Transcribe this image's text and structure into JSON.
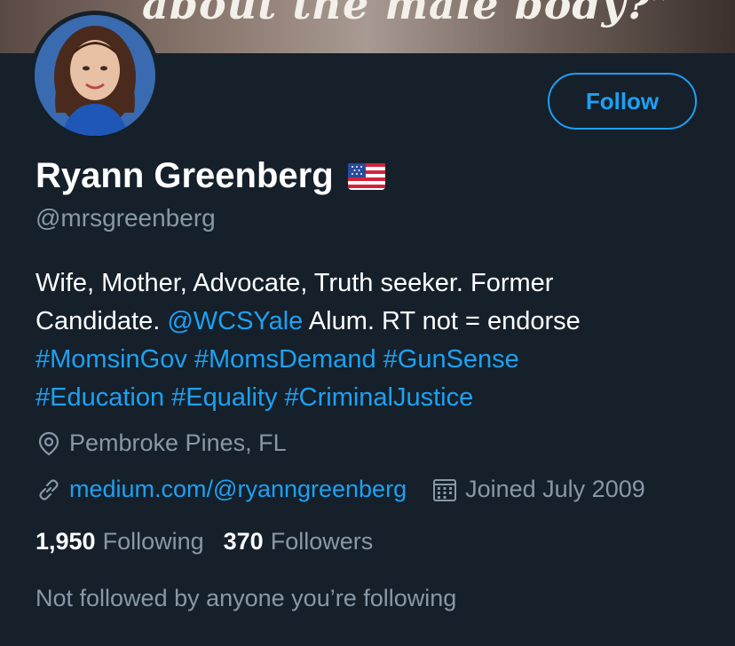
{
  "banner": {
    "text": "about the male body?”"
  },
  "profile": {
    "name": "Ryann Greenberg",
    "handle": "@mrsgreenberg",
    "follow_label": "Follow"
  },
  "bio": {
    "line1": "Wife, Mother, Advocate, Truth seeker. Former",
    "line2_pre": "Candidate. ",
    "mention": "@WCSYale",
    "line2_post": " Alum. RT not = endorse",
    "hashtags_line3": "#MomsinGov #MomsDemand #GunSense",
    "hashtags_line4": "#Education #Equality #CriminalJustice"
  },
  "meta": {
    "location": "Pembroke Pines, FL",
    "url": "medium.com/@ryanngreenberg",
    "joined": "Joined July 2009"
  },
  "counts": {
    "following_count": "1,950",
    "following_label": "Following",
    "followers_count": "370",
    "followers_label": "Followers"
  },
  "not_followed_text": "Not followed by anyone you’re following",
  "colors": {
    "background": "#15202b",
    "accent": "#1da1f2",
    "secondary_text": "#8899a6"
  },
  "icons": [
    "location-pin-icon",
    "link-icon",
    "calendar-icon",
    "us-flag-icon"
  ]
}
